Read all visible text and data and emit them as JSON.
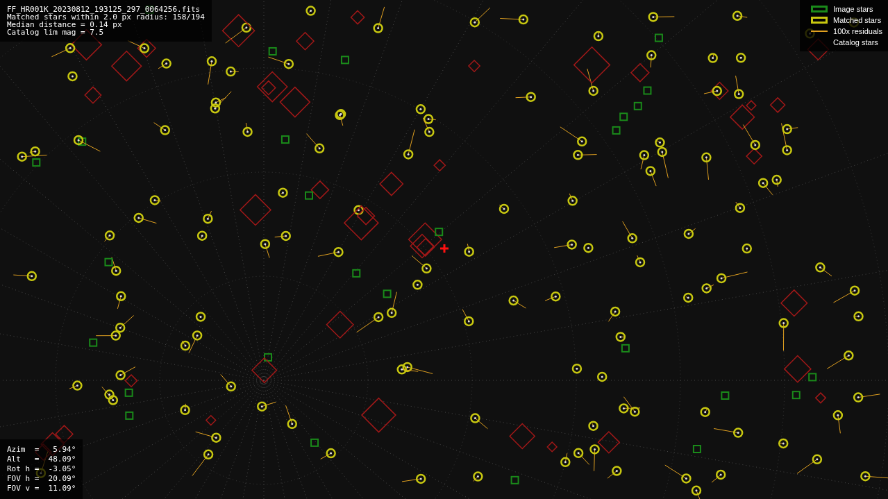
{
  "info": {
    "lines": [
      "FF_HR001K_20230812_193125_297_0064256.fits",
      "Matched stars within 2.0 px radius: 158/194",
      "Median distance = 0.14 px",
      "Catalog lim mag = 7.5"
    ]
  },
  "legend": [
    {
      "label": "Image stars",
      "kind": "box",
      "color": "#1a8a1a"
    },
    {
      "label": "Matched stars",
      "kind": "box",
      "color": "#c8c810"
    },
    {
      "label": "100x residuals",
      "kind": "line",
      "color": "#e0a020"
    },
    {
      "label": "Catalog stars",
      "kind": "blank"
    }
  ],
  "pointing": {
    "lines": [
      "Azim  =   5.94°",
      "Alt   =  48.09°",
      "Rot h =  -3.05°",
      "FOV h =  20.09°",
      "FOV v =  11.09°"
    ]
  }
}
